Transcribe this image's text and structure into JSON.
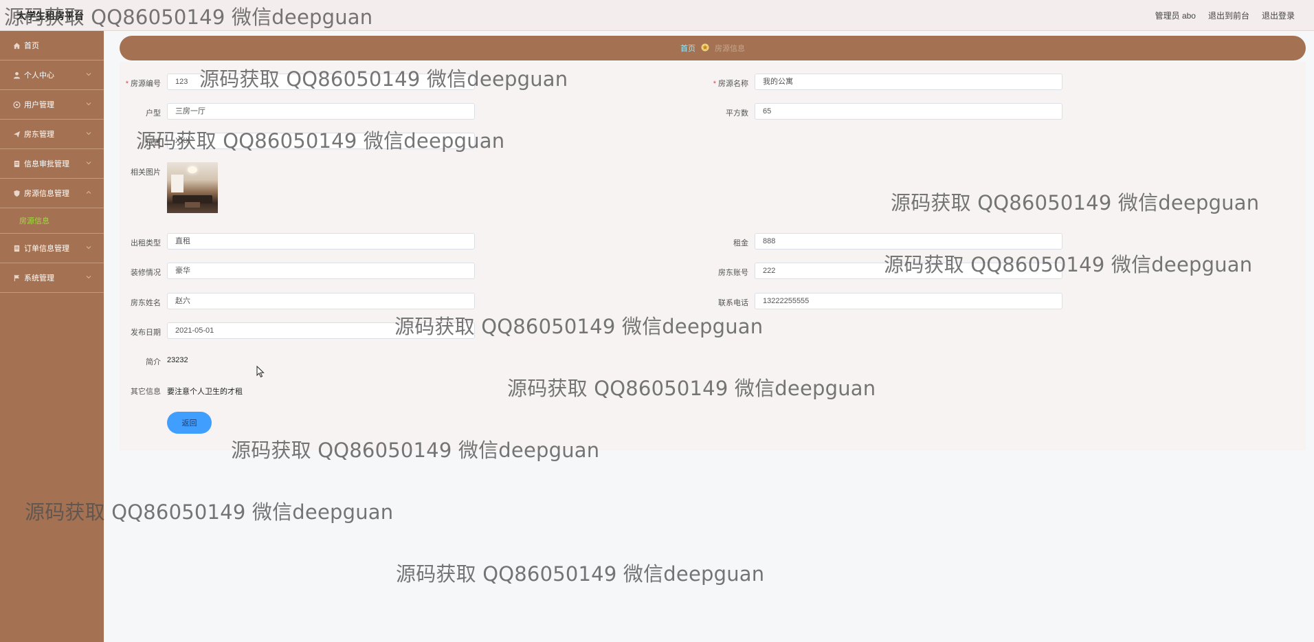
{
  "app": {
    "title": "大学生租房平台",
    "user_label": "管理员 abo",
    "to_front_label": "退出到前台",
    "logout_label": "退出登录"
  },
  "sidebar": {
    "items": [
      {
        "label": "首页",
        "icon": "home-icon"
      },
      {
        "label": "个人中心",
        "icon": "user-icon"
      },
      {
        "label": "用户管理",
        "icon": "users-icon"
      },
      {
        "label": "房东管理",
        "icon": "send-icon"
      },
      {
        "label": "信息审批管理",
        "icon": "doc-icon"
      },
      {
        "label": "房源信息管理",
        "icon": "shield-icon"
      },
      {
        "label": "房源信息",
        "icon": ""
      },
      {
        "label": "订单信息管理",
        "icon": "doc-icon"
      },
      {
        "label": "系统管理",
        "icon": "flag-icon"
      }
    ]
  },
  "breadcrumb": {
    "home": "首页",
    "current": "房源信息"
  },
  "form": {
    "fields": {
      "code": {
        "label": "房源编号",
        "value": "123",
        "required": true
      },
      "name": {
        "label": "房源名称",
        "value": "我的公寓",
        "required": true
      },
      "layout": {
        "label": "户型",
        "value": "三房一厅"
      },
      "area": {
        "label": "平方数",
        "value": "65"
      },
      "location": {
        "label": "位置",
        "value": "XXX"
      },
      "image": {
        "label": "相关图片"
      },
      "rent_type": {
        "label": "出租类型",
        "value": "直租"
      },
      "rent": {
        "label": "租金",
        "value": "888"
      },
      "decoration": {
        "label": "装修情况",
        "value": "豪华"
      },
      "landlord_account": {
        "label": "房东账号",
        "value": "222"
      },
      "landlord_name": {
        "label": "房东姓名",
        "value": "赵六"
      },
      "phone": {
        "label": "联系电话",
        "value": "13222255555"
      },
      "publish_date": {
        "label": "发布日期",
        "value": "2021-05-01"
      },
      "intro": {
        "label": "简介",
        "value": "23232"
      },
      "other": {
        "label": "其它信息",
        "value": "要注意个人卫生的才租"
      }
    },
    "back_label": "返回"
  },
  "watermark": "源码获取 QQ86050149 微信deepguan"
}
